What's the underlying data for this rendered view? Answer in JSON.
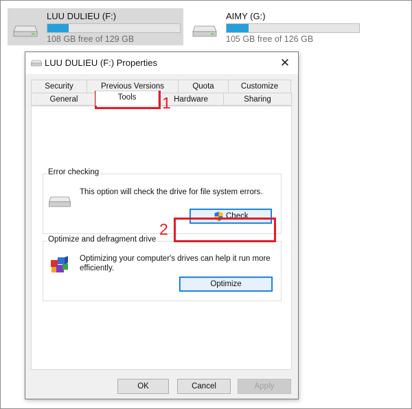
{
  "drives": [
    {
      "name": "LUU DULIEU (F:)",
      "free_text": "108 GB free of 129 GB",
      "used_fraction": 0.163
    },
    {
      "name": "AIMY (G:)",
      "free_text": "105 GB free of 126 GB",
      "used_fraction": 0.167
    }
  ],
  "dialog": {
    "title": "LUU DULIEU (F:) Properties",
    "close": "✕",
    "tabs_row1": [
      "Security",
      "Previous Versions",
      "Quota",
      "Customize"
    ],
    "tabs_row2": [
      "General",
      "Tools",
      "Hardware",
      "Sharing"
    ],
    "active_tab": "Tools",
    "error_checking": {
      "title": "Error checking",
      "description": "This option will check the drive for file system errors.",
      "button": "Check"
    },
    "optimize": {
      "title": "Optimize and defragment drive",
      "description": "Optimizing your computer's drives can help it run more efficiently.",
      "button": "Optimize"
    },
    "buttons": {
      "ok": "OK",
      "cancel": "Cancel",
      "apply": "Apply"
    }
  },
  "annotations": {
    "step1": "1",
    "step2": "2"
  },
  "colors": {
    "accent_red": "#e21b2a",
    "bar_blue": "#26a0da",
    "focus_blue": "#0078d7"
  }
}
